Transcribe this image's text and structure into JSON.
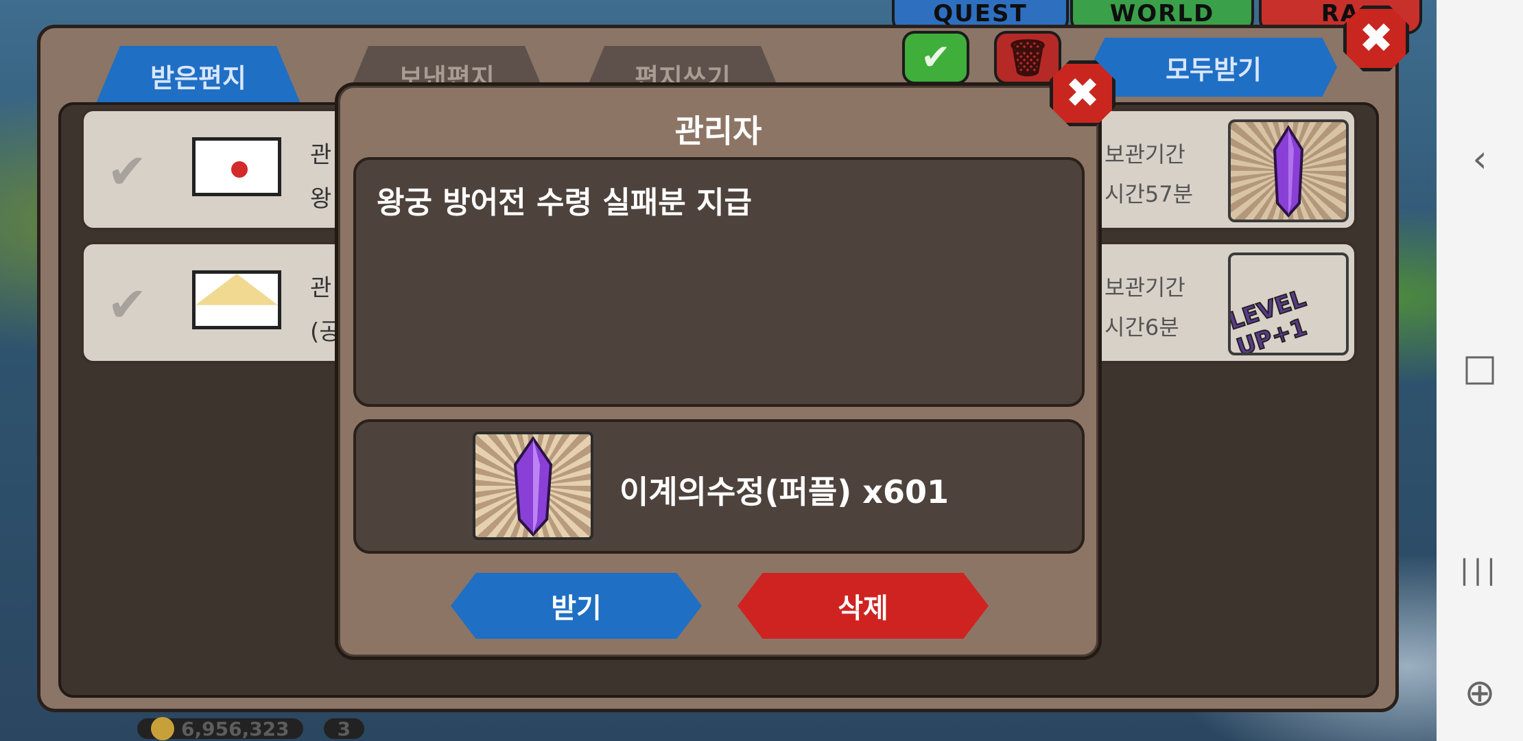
{
  "game_tabs": {
    "quest": "QUEST",
    "world": "WORLD",
    "raid": "RA"
  },
  "currency": {
    "gold": "6,956,323",
    "gem": "3"
  },
  "mailbox": {
    "tabs": [
      {
        "label": "받은편지",
        "active": true
      },
      {
        "label": "보낸편지",
        "active": false
      },
      {
        "label": "편지쓰기",
        "active": false
      }
    ],
    "receive_all_label": "모두받기",
    "check_icon": "✔",
    "trash_icon": "🗑",
    "close_icon": "✖",
    "rows": [
      {
        "sender_prefix": "관",
        "line2_prefix": "왕",
        "retention_label": "보관기간",
        "time_left": "시간57분",
        "icon": "sealed-envelope"
      },
      {
        "sender_prefix": "관",
        "line2_prefix": "(공",
        "retention_label": "보관기간",
        "time_left": "시간6분",
        "icon": "open-envelope",
        "badge": "LEVEL UP+1"
      }
    ]
  },
  "modal": {
    "title": "관리자",
    "message": "왕궁 방어전 수령 실패분 지급",
    "reward": {
      "name": "이계의수정(퍼플) x601"
    },
    "receive_label": "받기",
    "delete_label": "삭제",
    "close_icon": "✖"
  },
  "nav": {
    "back": "‹",
    "home": "□",
    "recents": "|||",
    "game": "⊕"
  }
}
